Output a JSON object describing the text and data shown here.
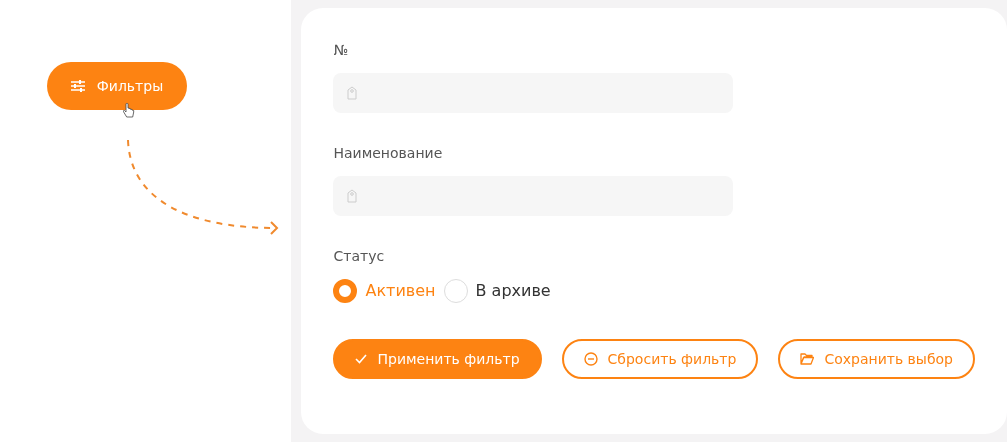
{
  "filter_button": {
    "label": "Фильтры"
  },
  "fields": [
    {
      "label": "№"
    },
    {
      "label": "Наименование"
    }
  ],
  "status": {
    "label": "Статус",
    "options": [
      {
        "label": "Активен",
        "selected": true
      },
      {
        "label": "В архиве",
        "selected": false
      }
    ]
  },
  "buttons": [
    {
      "kind": "apply",
      "label": "Применить фильтр"
    },
    {
      "kind": "reset",
      "label": "Сбросить фильтр"
    },
    {
      "kind": "save",
      "label": "Сохранить выбор"
    }
  ]
}
